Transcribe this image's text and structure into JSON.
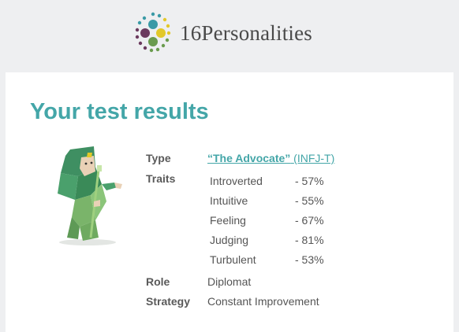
{
  "header": {
    "brand_number": "16",
    "brand_name": "Personalities"
  },
  "page": {
    "title": "Your test results"
  },
  "result": {
    "type_label": "Type",
    "type_nickname": "“The Advocate”",
    "type_code": "(INFJ-T)",
    "traits_label": "Traits",
    "traits": [
      {
        "name": "Introverted",
        "value": "- 57%"
      },
      {
        "name": "Intuitive",
        "value": "- 55%"
      },
      {
        "name": "Feeling",
        "value": "- 67%"
      },
      {
        "name": "Judging",
        "value": "- 81%"
      },
      {
        "name": "Turbulent",
        "value": "- 53%"
      }
    ],
    "role_label": "Role",
    "role_value": "Diplomat",
    "strategy_label": "Strategy",
    "strategy_value": "Constant Improvement"
  },
  "colors": {
    "accent": "#44a6a8",
    "logo_purple": "#6b3a5e",
    "logo_teal": "#3a9aa6",
    "logo_yellow": "#e2c829",
    "logo_green": "#6a9b4e",
    "avatar_green": "#4f9a5f"
  },
  "icons": {
    "logo": "16personalities-dots-logo",
    "avatar": "advocate-character-illustration"
  }
}
